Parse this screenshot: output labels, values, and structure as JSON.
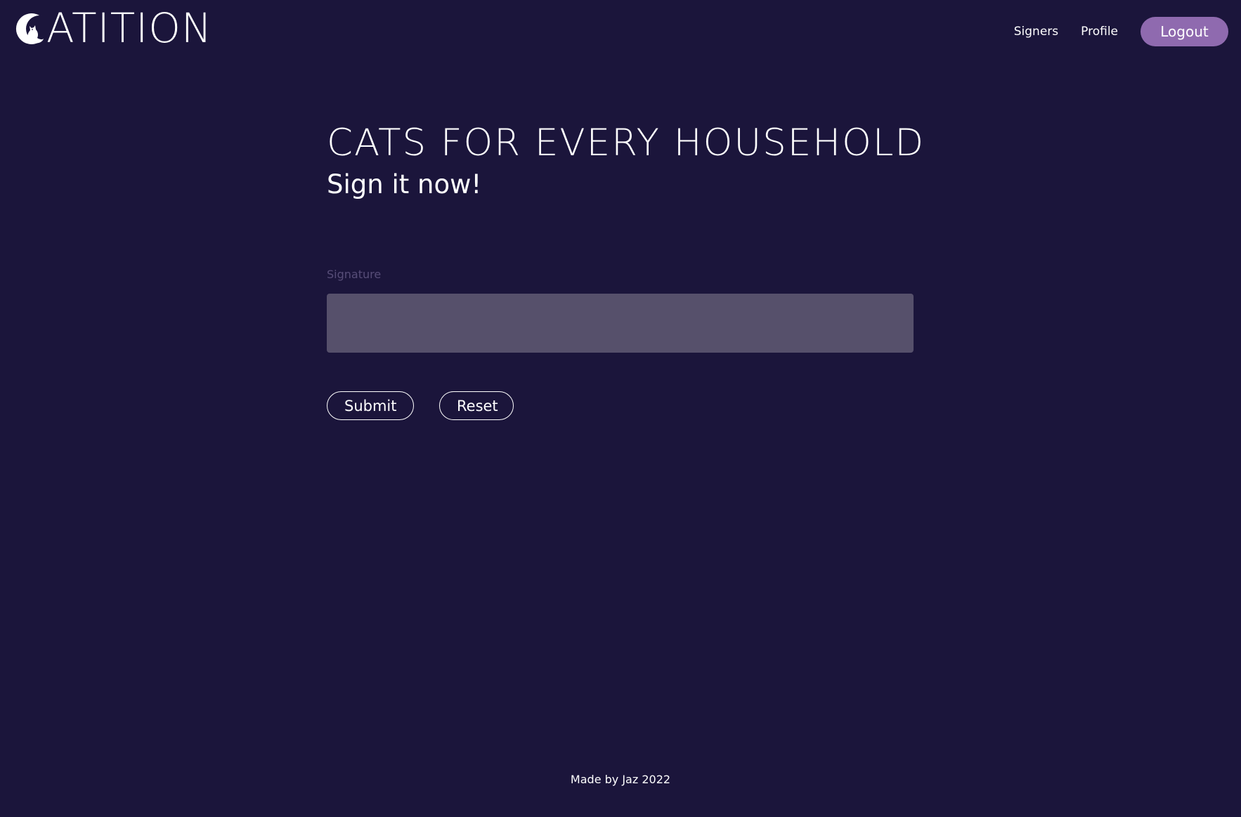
{
  "header": {
    "logo_text": "ATITION",
    "logo_icon": "cat-moon-icon",
    "nav": {
      "signers_label": "Signers",
      "profile_label": "Profile",
      "logout_label": "Logout"
    }
  },
  "main": {
    "title": "CATS FOR EVERY HOUSEHOLD",
    "subtitle": "Sign it now!",
    "signature_label": "Signature",
    "submit_label": "Submit",
    "reset_label": "Reset"
  },
  "footer": {
    "text": "Made by Jaz 2022"
  },
  "colors": {
    "background": "#1b153b",
    "accent": "#8f6aaf",
    "canvas": "#56506b",
    "label": "#574d78"
  }
}
